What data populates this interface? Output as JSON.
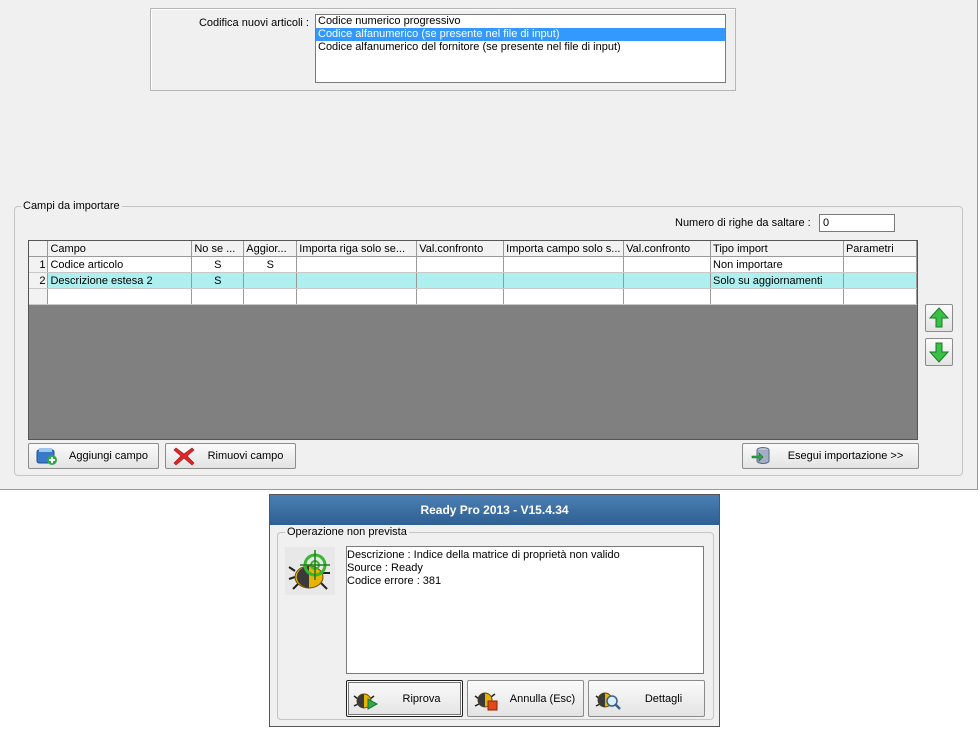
{
  "codifica": {
    "label": "Codifica nuovi articoli :",
    "options": [
      "Codice numerico progressivo",
      "Codice alfanumerico (se presente nel file di input)",
      "Codice alfanumerico del fornitore (se presente nel file di input)"
    ],
    "selected_index": 1
  },
  "campi": {
    "title": "Campi da importare",
    "skip_label": "Numero di righe da saltare  :",
    "skip_value": "0",
    "columns": [
      "Campo",
      "No se ...",
      "Aggior...",
      "Importa riga solo se...",
      "Val.confronto",
      "Importa campo solo s...",
      "Val.confronto",
      "Tipo import",
      "Parametri"
    ],
    "rows": [
      {
        "n": "1",
        "cells": [
          "Codice articolo",
          "S",
          "S",
          "",
          "",
          "",
          "",
          "Non importare",
          ""
        ]
      },
      {
        "n": "2",
        "cells": [
          "Descrizione estesa 2",
          "S",
          "",
          "",
          "",
          "",
          "",
          "Solo su aggiornamenti",
          ""
        ]
      }
    ],
    "buttons": {
      "add": "Aggiungi campo",
      "remove": "Rimuovi campo",
      "execute": "Esegui importazione >>"
    },
    "colors": {
      "highlight_row": "#aef0f0",
      "grid_empty": "#808080"
    }
  },
  "dialog": {
    "title": "Ready Pro 2013 - V15.4.34",
    "group_title": "Operazione non prevista",
    "message_lines": [
      "Descrizione : Indice della matrice di proprietà non valido",
      "Source : Ready",
      "Codice errore : 381"
    ],
    "buttons": {
      "retry": "Riprova",
      "cancel": "Annulla (Esc)",
      "details": "Dettagli"
    }
  }
}
